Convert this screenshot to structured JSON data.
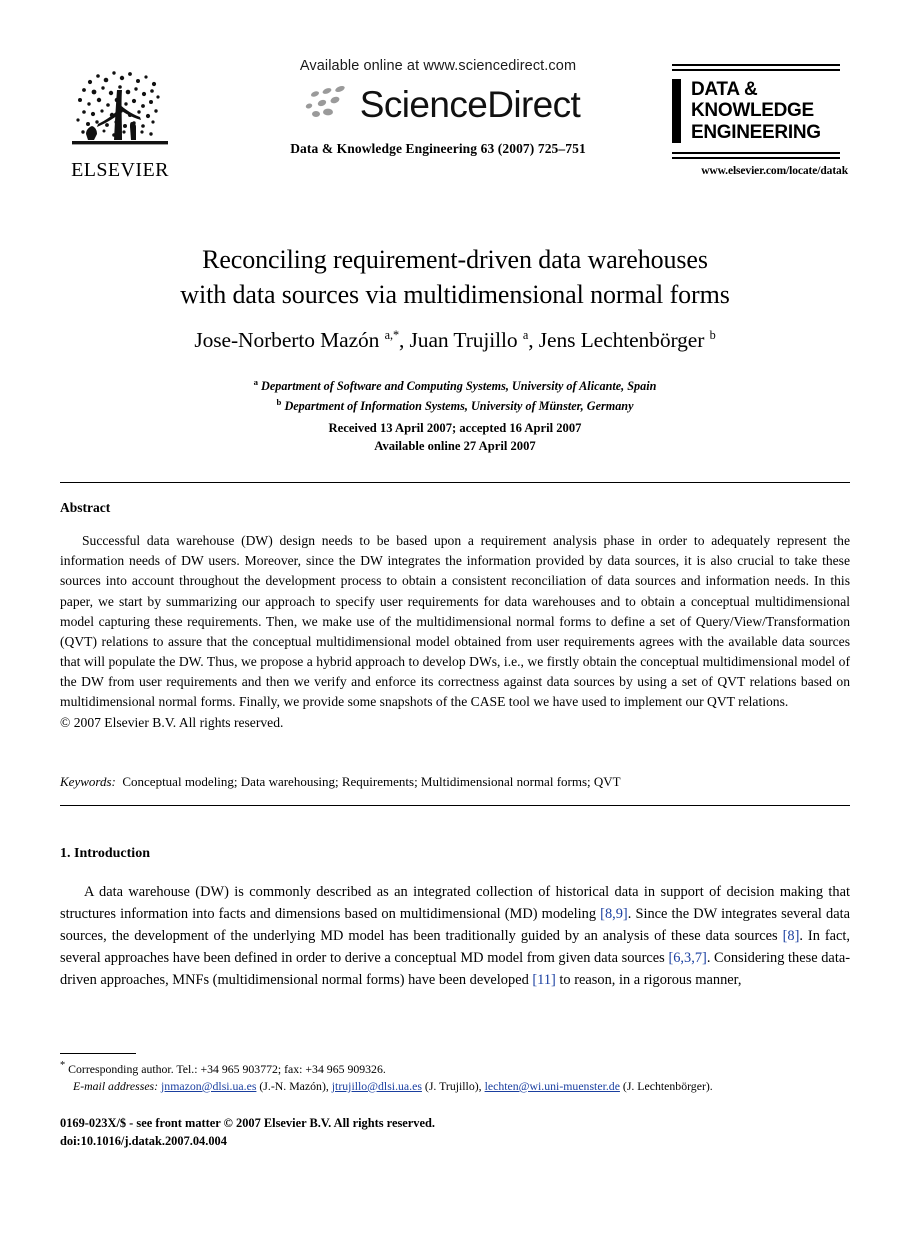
{
  "header": {
    "publisher_logo_name": "ELSEVIER",
    "available_online": "Available online at www.sciencedirect.com",
    "sciencedirect_wordmark": "ScienceDirect",
    "journal_reference": "Data & Knowledge Engineering 63 (2007) 725–751",
    "journal_logo_line1": "DATA &",
    "journal_logo_line2": "KNOWLEDGE",
    "journal_logo_line3": "ENGINEERING",
    "journal_url": "www.elsevier.com/locate/datak"
  },
  "article": {
    "title_line1": "Reconciling requirement-driven data warehouses",
    "title_line2": "with data sources via multidimensional normal forms",
    "authors_html": "Jose-Norberto Mazón a,*, Juan Trujillo a, Jens Lechtenbörger b",
    "affiliation_a": "Department of Software and Computing Systems, University of Alicante, Spain",
    "affiliation_b": "Department of Information Systems, University of Münster, Germany",
    "received": "Received 13 April 2007; accepted 16 April 2007",
    "available_online_date": "Available online 27 April 2007"
  },
  "abstract": {
    "heading": "Abstract",
    "text": "Successful data warehouse (DW) design needs to be based upon a requirement analysis phase in order to adequately represent the information needs of DW users. Moreover, since the DW integrates the information provided by data sources, it is also crucial to take these sources into account throughout the development process to obtain a consistent reconciliation of data sources and information needs. In this paper, we start by summarizing our approach to specify user requirements for data warehouses and to obtain a conceptual multidimensional model capturing these requirements. Then, we make use of the multidimensional normal forms to define a set of Query/View/Transformation (QVT) relations to assure that the conceptual multidimensional model obtained from user requirements agrees with the available data sources that will populate the DW. Thus, we propose a hybrid approach to develop DWs, i.e., we firstly obtain the conceptual multidimensional model of the DW from user requirements and then we verify and enforce its correctness against data sources by using a set of QVT relations based on multidimensional normal forms. Finally, we provide some snapshots of the CASE tool we have used to implement our QVT relations.",
    "copyright": "© 2007 Elsevier B.V. All rights reserved."
  },
  "keywords": {
    "label": "Keywords:",
    "value": "Conceptual modeling; Data warehousing; Requirements; Multidimensional normal forms; QVT"
  },
  "section1": {
    "heading": "1. Introduction",
    "p1_part1": "A data warehouse (DW) is commonly described as an integrated collection of historical data in support of decision making that structures information into facts and dimensions based on multidimensional (MD) modeling ",
    "cite1": "[8,9]",
    "p1_part2": ". Since the DW integrates several data sources, the development of the underlying MD model has been traditionally guided by an analysis of these data sources ",
    "cite2": "[8]",
    "p1_part3": ". In fact, several approaches have been defined in order to derive a conceptual MD model from given data sources ",
    "cite3": "[6,3,7]",
    "p1_part4": ". Considering these data-driven approaches, MNFs (multidimensional normal forms) have been developed ",
    "cite4": "[11]",
    "p1_part5": " to reason, in a rigorous manner,"
  },
  "footnote": {
    "corresponding_marker": "*",
    "corresponding_text": "Corresponding author. Tel.: +34 965 903772; fax: +34 965 909326.",
    "email_label": "E-mail addresses:",
    "email1": "jnmazon@dlsi.ua.es",
    "email1_owner": "(J.-N. Mazón),",
    "email2": "jtrujillo@dlsi.ua.es",
    "email2_owner": "(J. Trujillo),",
    "email3": "lechten@wi.uni-muenster.de",
    "email3_owner": "(J. Lechtenbörger)."
  },
  "frontmatter": {
    "line1": "0169-023X/$ - see front matter © 2007 Elsevier B.V. All rights reserved.",
    "line2": "doi:10.1016/j.datak.2007.04.004"
  },
  "colors": {
    "link": "#1a3fa0",
    "text": "#000000",
    "background": "#ffffff"
  }
}
